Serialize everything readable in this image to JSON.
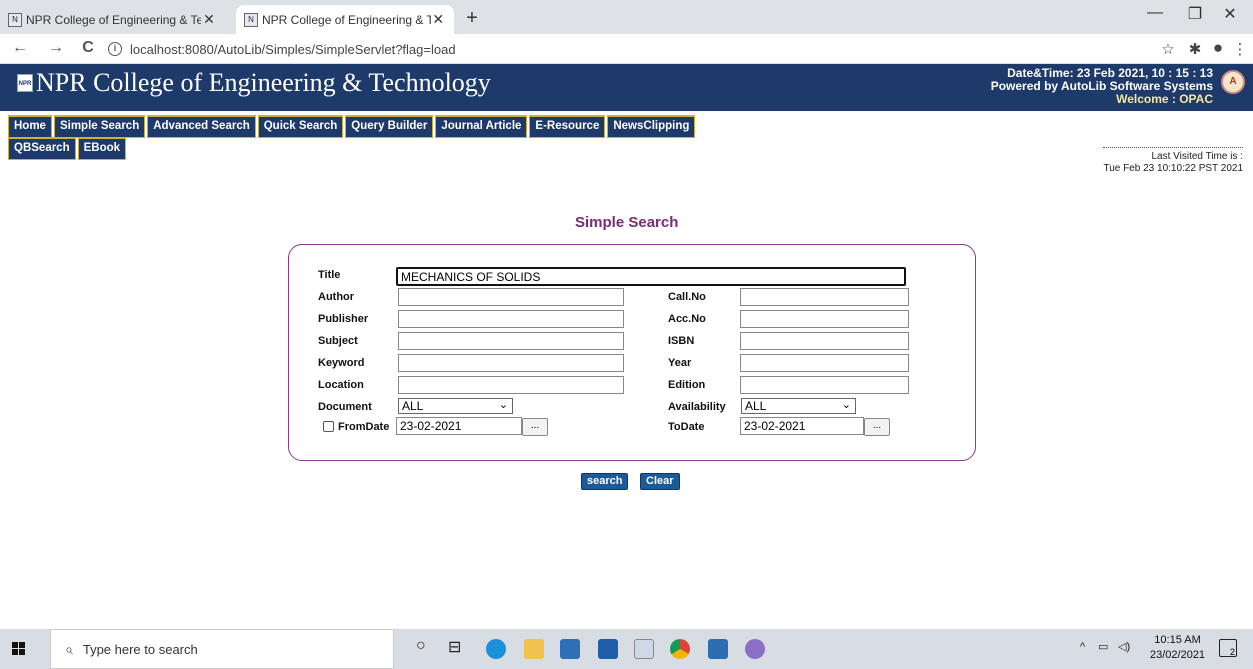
{
  "browser": {
    "tabs": [
      {
        "title": "NPR College of Engineering & Te",
        "close": "✕"
      },
      {
        "title": "NPR College of Engineering & Te",
        "close": "✕"
      }
    ],
    "new_tab": "+",
    "window_controls": {
      "minimize": "—",
      "restore": "❐",
      "close": "✕"
    },
    "nav": {
      "back": "←",
      "forward": "→",
      "reload": "C"
    },
    "url": "localhost:8080/AutoLib/Simples/SimpleServlet?flag=load",
    "info_icon": "i",
    "toolbar_icons": {
      "star": "☆",
      "extensions": "✱",
      "profile": "●",
      "menu": "⋮"
    }
  },
  "header": {
    "logo_text": "NPR",
    "college_name": "NPR College of Engineering & Technology",
    "datetime": "Date&Time:  23 Feb 2021, 10 : 15 : 13",
    "powered_by": "Powered by AutoLib Software Systems",
    "welcome": "Welcome  : OPAC",
    "autolib_logo": "A"
  },
  "menu": {
    "row1": [
      "Home",
      "Simple Search",
      "Advanced Search",
      "Quick Search",
      "Query Builder",
      "Journal Article",
      "E-Resource",
      "NewsClipping"
    ],
    "row2": [
      "QBSearch",
      "EBook"
    ]
  },
  "last_visited": {
    "label": "Last Visited Time is :",
    "value": "Tue Feb 23 10:10:22 PST 2021"
  },
  "page_title": "Simple Search",
  "form": {
    "title_label": "Title",
    "title_value": "MECHANICS OF SOLIDS",
    "author_label": "Author",
    "author_value": "",
    "publisher_label": "Publisher",
    "publisher_value": "",
    "subject_label": "Subject",
    "subject_value": "",
    "keyword_label": "Keyword",
    "keyword_value": "",
    "location_label": "Location",
    "location_value": "",
    "document_label": "Document",
    "document_value": "ALL",
    "fromdate_label": "FromDate",
    "fromdate_value": "23-02-2021",
    "fromdate_checked": false,
    "callno_label": "Call.No",
    "callno_value": "",
    "accno_label": "Acc.No",
    "accno_value": "",
    "isbn_label": "ISBN",
    "isbn_value": "",
    "year_label": "Year",
    "year_value": "",
    "edition_label": "Edition",
    "edition_value": "",
    "availability_label": "Availability",
    "availability_value": "ALL",
    "todate_label": "ToDate",
    "todate_value": "23-02-2021",
    "picker_label": "...",
    "caret": "⌄"
  },
  "buttons": {
    "search": "search",
    "clear": "Clear"
  },
  "taskbar": {
    "search_placeholder": "Type here to search",
    "search_glyph": "⌕",
    "cortana_glyph": "○",
    "taskview_glyph": "⊟",
    "tray_chevron": "^",
    "clock_time": "10:15 AM",
    "clock_date": "23/02/2021",
    "notifications": "2"
  }
}
